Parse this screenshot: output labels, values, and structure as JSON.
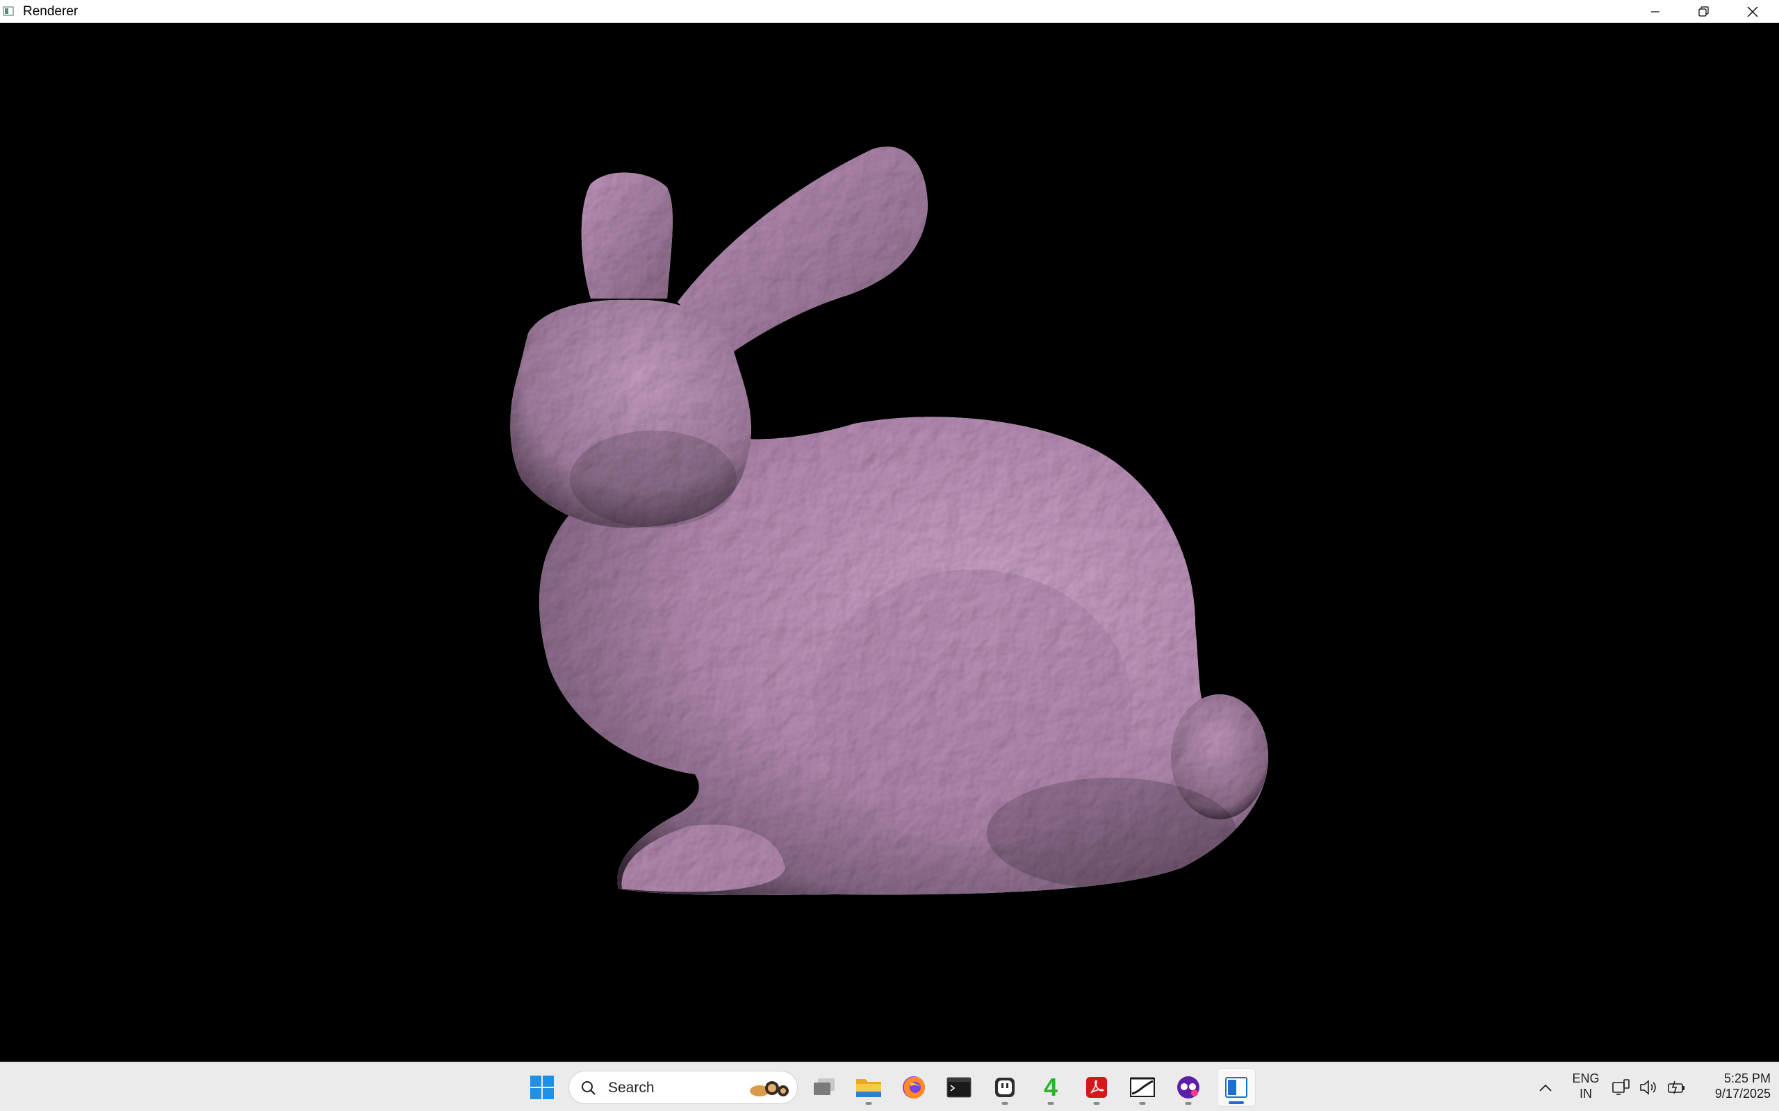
{
  "window": {
    "title": "Renderer",
    "controls": [
      "minimize",
      "restore",
      "close"
    ]
  },
  "viewport": {
    "background": "#000000",
    "model_color": "#c79ac4"
  },
  "taskbar": {
    "search": {
      "label": "Search"
    },
    "pinned": [
      {
        "name": "start",
        "icon": "windows-start-icon"
      },
      {
        "name": "task-view",
        "icon": "task-view-icon"
      },
      {
        "name": "file-explorer",
        "icon": "folder-icon"
      },
      {
        "name": "firefox",
        "icon": "firefox-icon"
      },
      {
        "name": "terminal",
        "icon": "terminal-icon"
      },
      {
        "name": "app-robot",
        "icon": "robot-icon"
      },
      {
        "name": "app-4",
        "icon": "number-4-icon",
        "glyph": "4"
      },
      {
        "name": "acrobat",
        "icon": "pdf-icon"
      },
      {
        "name": "app-curve",
        "icon": "curve-app-icon"
      },
      {
        "name": "app-mask",
        "icon": "mask-icon"
      },
      {
        "name": "renderer",
        "icon": "renderer-app-icon",
        "active": true
      }
    ],
    "tray": {
      "language_top": "ENG",
      "language_bottom": "IN",
      "time": "5:25 PM",
      "date": "9/17/2025"
    }
  }
}
